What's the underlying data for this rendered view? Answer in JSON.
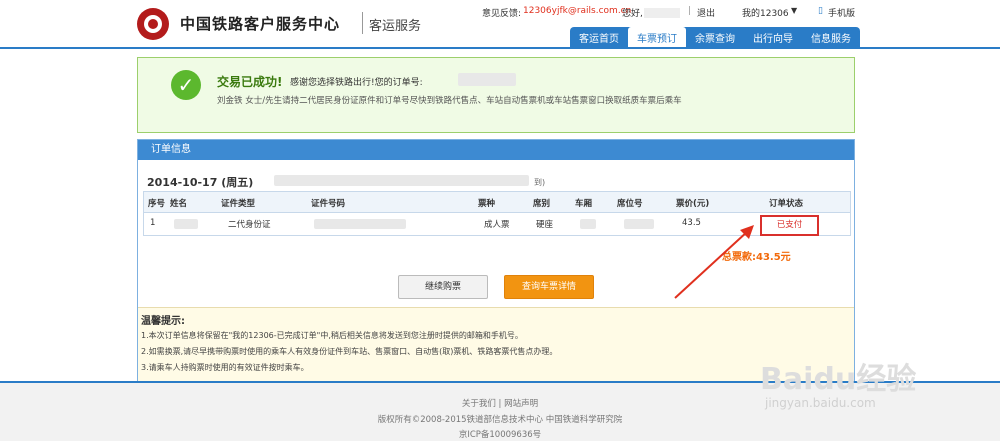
{
  "header": {
    "brand": "中国铁路客户服务中心",
    "sub": "客运服务",
    "feedback_label": "意见反馈:",
    "feedback_email": "12306yjfk@rails.com.cn",
    "greeting": "您好,",
    "logout": "退出",
    "my12306": "我的12306",
    "mobile": "手机版"
  },
  "nav": [
    "客运首页",
    "车票预订",
    "余票查询",
    "出行向导",
    "信息服务"
  ],
  "success": {
    "title": "交易已成功!",
    "msg": "感谢您选择铁路出行!您的订单号:",
    "note": "刘金铁 女士/先生请持二代居民身份证原件和订单号尽快到铁路代售点、车站自动售票机或车站售票窗口换取纸质车票后乘车"
  },
  "order": {
    "heading": "订单信息",
    "date": "2014-10-17 (周五)",
    "date_tail": "到)",
    "columns": [
      "序号",
      "姓名",
      "证件类型",
      "证件号码",
      "票种",
      "席别",
      "车厢",
      "席位号",
      "票价(元)",
      "订单状态"
    ],
    "row": {
      "index": "1",
      "id_type": "二代身份证",
      "ticket_type": "成人票",
      "seat_class": "硬座",
      "price": "43.5",
      "status": "已支付"
    },
    "total": "总票款:43.5元",
    "continue_btn": "继续购票",
    "detail_btn": "查询车票详情"
  },
  "tips": {
    "title": "温馨提示:",
    "lines": [
      "1.本次订单信息将保留在\"我的12306-已完成订单\"中,稍后相关信息将发送到您注册时提供的邮箱和手机号。",
      "2.如需换票,请尽早携带购票时使用的乘车人有效身份证件到车站、售票窗口、自动售(取)票机、铁路客票代售点办理。",
      "3.请乘车人持购票时使用的有效证件按时乘车。"
    ]
  },
  "footer": {
    "links": "关于我们 | 网站声明",
    "copyright": "版权所有©2008-2015铁道部信息技术中心 中国铁道科学研究院",
    "icp": "京ICP备10009636号"
  },
  "watermark": {
    "main": "Baidu经验",
    "sub": "jingyan.baidu.com"
  }
}
